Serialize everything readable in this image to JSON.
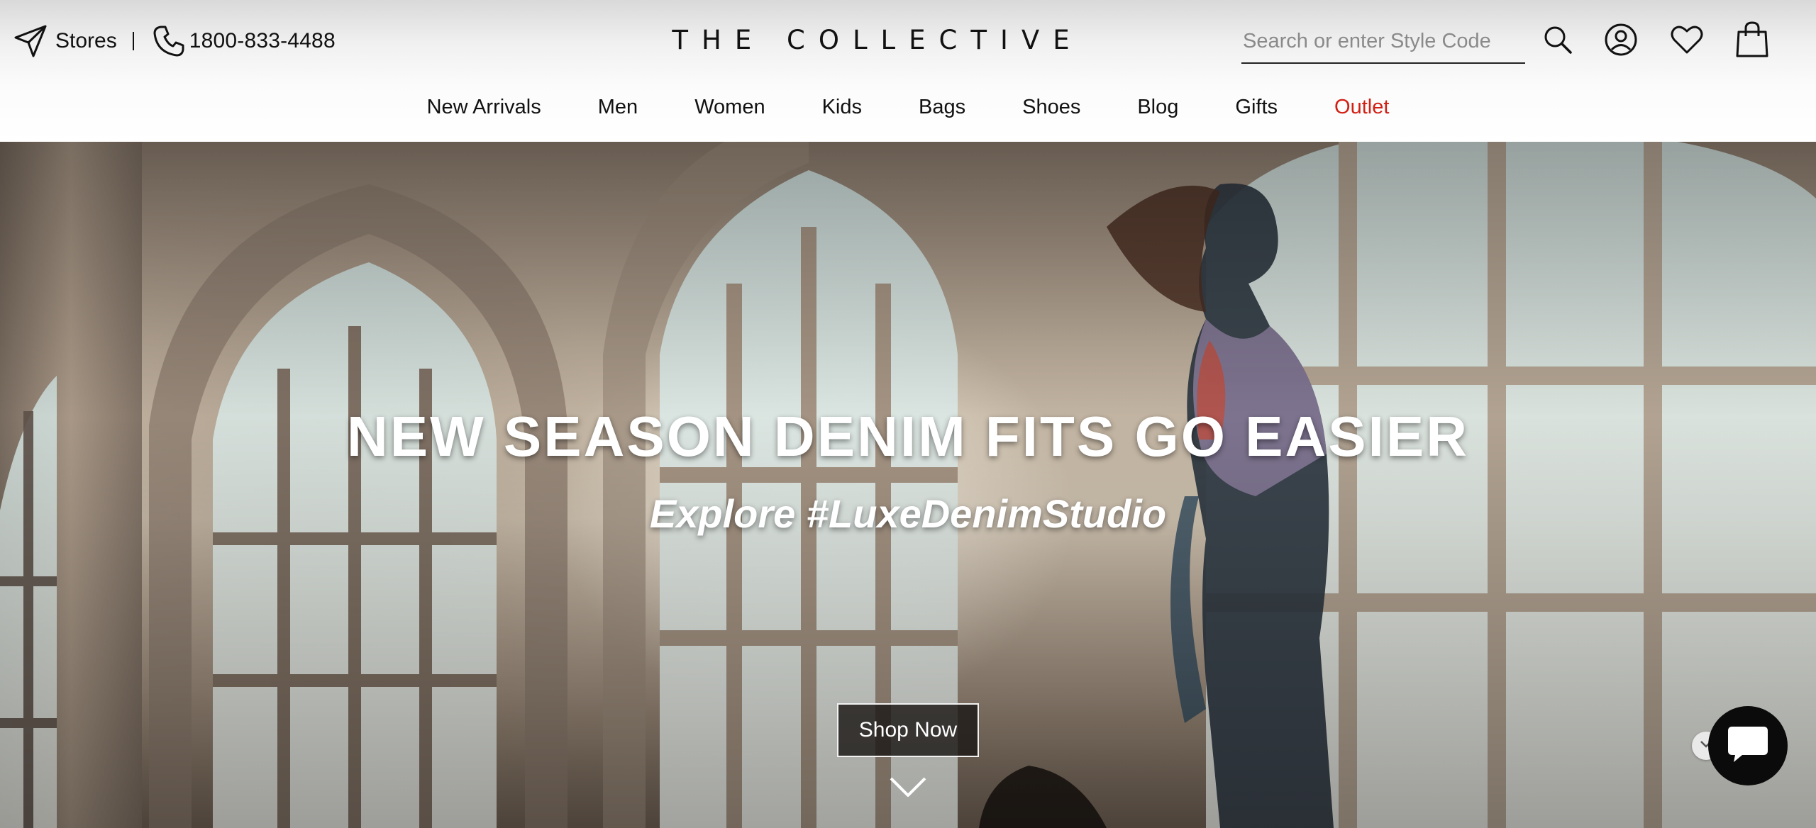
{
  "header": {
    "stores_label": "Stores",
    "phone": "1800-833-4488",
    "logo": "THE COLLECTIVE",
    "search": {
      "placeholder": "Search or enter Style Code",
      "value": ""
    },
    "icons": [
      "navigation-arrow-icon",
      "phone-icon",
      "search-icon",
      "account-icon",
      "wishlist-heart-icon",
      "shopping-bag-icon"
    ]
  },
  "nav": {
    "items": [
      "New Arrivals",
      "Men",
      "Women",
      "Kids",
      "Bags",
      "Shoes",
      "Blog",
      "Gifts",
      "Outlet"
    ],
    "sale_color": "#d11f14"
  },
  "hero": {
    "title": "NEW SEASON DENIM FITS GO EASIER",
    "subtitle": "Explore #LuxeDenimStudio",
    "cta_label": "Shop Now"
  },
  "chat": {
    "icons": [
      "chat-bubble-icon",
      "chevron-down-icon"
    ]
  },
  "colors": {
    "text": "#111111",
    "sale": "#d11f14",
    "cta_bg": "#1c1816",
    "chat_bg": "#0b0b0b"
  }
}
